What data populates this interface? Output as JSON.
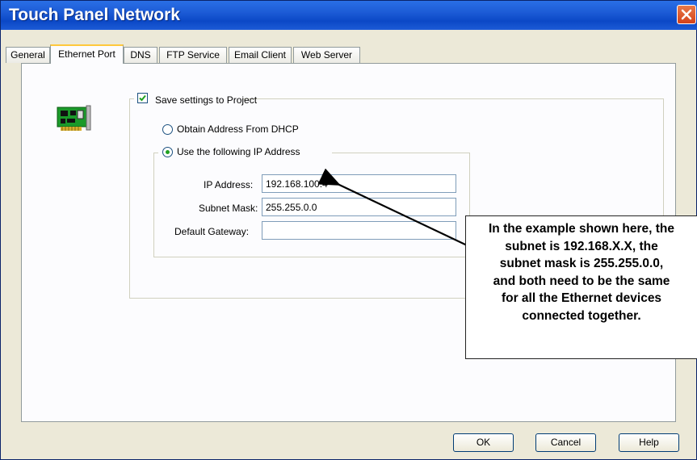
{
  "window": {
    "title": "Touch Panel Network"
  },
  "tabs": [
    {
      "label": "General"
    },
    {
      "label": "Ethernet Port"
    },
    {
      "label": "DNS"
    },
    {
      "label": "FTP Service"
    },
    {
      "label": "Email Client"
    },
    {
      "label": "Web Server"
    }
  ],
  "active_tab": "Ethernet Port",
  "ethernet": {
    "save_settings_label": "Save settings to Project",
    "save_settings_checked": true,
    "dhcp_label": "Obtain Address From DHCP",
    "static_label": "Use the following IP Address",
    "static_selected": true,
    "ip_label": "IP Address:",
    "ip_value": "192.168.100.4",
    "subnet_label": "Subnet Mask:",
    "subnet_value": "255.255.0.0",
    "gateway_label": "Default Gateway:",
    "gateway_value": ""
  },
  "callout": {
    "lines": [
      "In the example shown here, the",
      "subnet is 192.168.X.X, the",
      "subnet mask is 255.255.0.0,",
      "and both need to be the same",
      "for all the Ethernet devices",
      "connected together."
    ]
  },
  "buttons": {
    "ok": "OK",
    "cancel": "Cancel",
    "help": "Help"
  },
  "colors": {
    "title_bar": "#1c5bd6",
    "close_button": "#d4411a",
    "active_tab_highlight": "#ffc83c",
    "radio_dot": "#21a121"
  },
  "icons": {
    "close": "close-icon",
    "network_card": "network-card-icon",
    "checkmark": "checkmark-icon"
  }
}
